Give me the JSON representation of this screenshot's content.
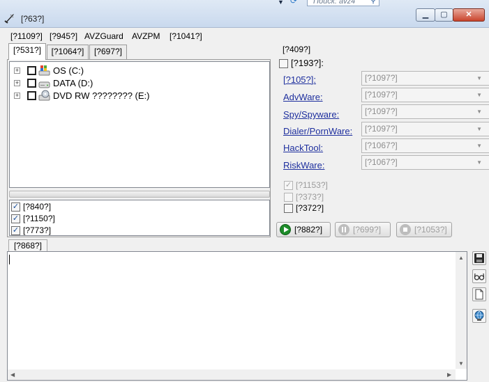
{
  "window": {
    "title": "[?63?]",
    "peek_search": "Поиск: avz4"
  },
  "menu": [
    "[?1109?]",
    "[?945?]",
    "AVZGuard",
    "AVZPM",
    "[?1041?]"
  ],
  "tabs": [
    "[?531?]",
    "[?1064?]",
    "[?697?]"
  ],
  "drives": [
    {
      "label": "OS (C:)",
      "icon": "system-drive-icon"
    },
    {
      "label": "DATA (D:)",
      "icon": "hard-drive-icon"
    },
    {
      "label": "DVD RW ???????? (E:)",
      "icon": "dvd-drive-icon"
    }
  ],
  "scan_options": [
    {
      "label": "[?840?]",
      "checked": true
    },
    {
      "label": "[?1150?]",
      "checked": true
    },
    {
      "label": "[?773?]",
      "checked": true
    }
  ],
  "actions_group": {
    "title": "[?409?]",
    "master_checkbox_label": "[?193?]:",
    "threats": [
      {
        "label": "[?105?]:",
        "action": "[?1097?]"
      },
      {
        "label": "AdvWare:",
        "action": "[?1097?]"
      },
      {
        "label": "Spy/Spyware:",
        "action": "[?1097?]"
      },
      {
        "label": "Dialer/PornWare:",
        "action": "[?1097?]"
      },
      {
        "label": "HackTool:",
        "action": "[?1067?]"
      },
      {
        "label": "RiskWare:",
        "action": "[?1067?]"
      }
    ],
    "extra_options": [
      {
        "label": "[?1153?]",
        "checked": true,
        "enabled": false
      },
      {
        "label": "[?373?]",
        "checked": false,
        "enabled": false
      },
      {
        "label": "[?372?]",
        "checked": false,
        "enabled": true
      }
    ]
  },
  "buttons": {
    "start": "[?882?]",
    "pause": "[?699?]",
    "stop": "[?1053?]"
  },
  "log": {
    "tab_label": "[?868?]",
    "text": ""
  },
  "colors": {
    "link": "#1e2f9e",
    "start_icon": "#1d8c2a",
    "close_button": "#c9442c"
  }
}
